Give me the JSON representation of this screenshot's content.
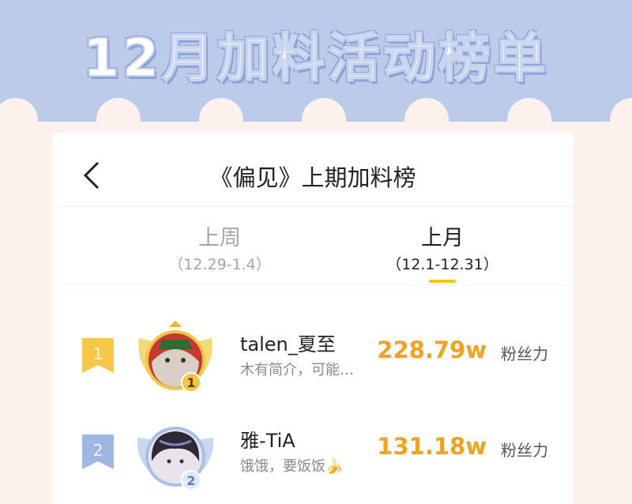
{
  "banner": {
    "title": "12月加料活动榜单"
  },
  "header": {
    "title": "《偏见》上期加料榜"
  },
  "tabs": [
    {
      "label": "上周",
      "range": "（12.29-1.4）",
      "active": false
    },
    {
      "label": "上月",
      "range": "（12.1-12.31）",
      "active": true
    }
  ],
  "leaderboard": [
    {
      "rank": "1",
      "name": "talen_夏至",
      "bio": "木有简介，可能…",
      "score": "228.79w",
      "unit": "粉丝力",
      "badge_color": "#f5c947"
    },
    {
      "rank": "2",
      "name": "雅-TiA",
      "bio": "饿饿，要饭饭🍌",
      "score": "131.18w",
      "unit": "粉丝力",
      "badge_color": "#9fb8e3"
    }
  ],
  "colors": {
    "banner_bg": "#bccbe9",
    "page_bg": "#fdf1ee",
    "accent_yellow": "#f5c518",
    "score_color": "#f0a323"
  }
}
